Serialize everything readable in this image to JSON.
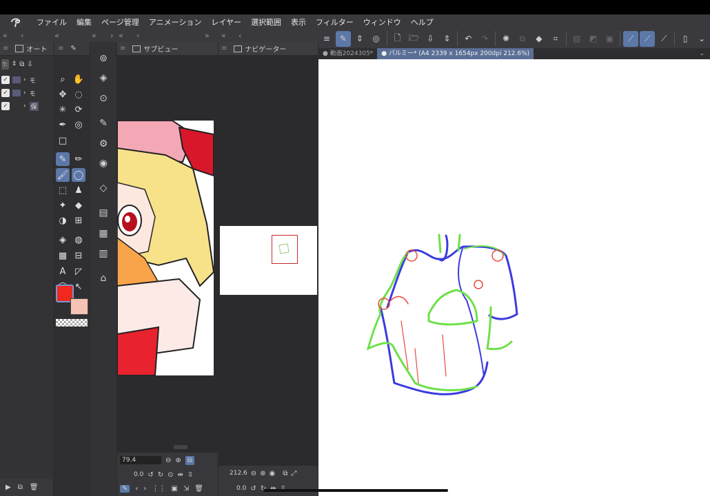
{
  "menu": {
    "items": [
      "ファイル",
      "編集",
      "ページ管理",
      "アニメーション",
      "レイヤー",
      "選択範囲",
      "表示",
      "フィルター",
      "ウィンドウ",
      "ヘルプ"
    ]
  },
  "layer_panel": {
    "title": "オート",
    "rows": [
      {
        "checked": true,
        "label": "モ"
      },
      {
        "checked": true,
        "label": "モ"
      },
      {
        "checked": true,
        "label": "保"
      }
    ],
    "blend_label": "ﾜ:"
  },
  "subview": {
    "title": "サブビュー",
    "zoom_value": "79.4",
    "rotate_value": "0.0"
  },
  "navigator": {
    "title": "ナビゲーター",
    "zoom_value": "212.6",
    "rotate_value": "0.0"
  },
  "canvas_tabs": [
    {
      "label": "● 動画2024305*",
      "active": false
    },
    {
      "label": "● パルミー* (A4 2339 x 1654px 200dpi 212.6%)",
      "active": true
    }
  ],
  "colors": {
    "main_color": "#f0281e",
    "sub_color": "#f5c2b4",
    "accent": "#5c78a8",
    "sketch_red": "#e8483a",
    "sketch_blue": "#3a3ae0",
    "sketch_green": "#6ee04a"
  },
  "tools": [
    "search-icon",
    "hand-icon",
    "move-icon",
    "lasso-icon",
    "magic-wand-icon",
    "rotate-select-icon",
    "eyedropper-icon",
    "spiral-icon",
    "rectangle-icon",
    "pen-icon",
    "pencil-icon",
    "brush-icon",
    "balloon-icon",
    "eraser-icon",
    "stamp-icon",
    "sparkle-icon",
    "eraser-2-icon",
    "blend-icon",
    "grid-icon",
    "fill-icon",
    "gradient-fill-icon",
    "gradient-icon",
    "frame-icon",
    "text-icon",
    "ruler-icon",
    "speech-icon",
    "correct-icon"
  ]
}
